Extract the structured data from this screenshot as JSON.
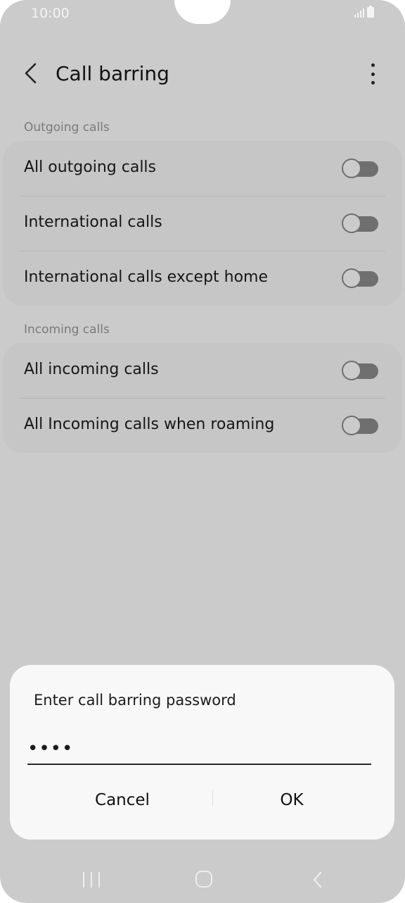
{
  "status_bar": {
    "time": "10:00"
  },
  "header": {
    "title": "Call barring"
  },
  "sections": [
    {
      "title": "Outgoing calls",
      "items": [
        {
          "label": "All outgoing calls",
          "enabled": false
        },
        {
          "label": "International calls",
          "enabled": false
        },
        {
          "label": "International calls except home",
          "enabled": false
        }
      ]
    },
    {
      "title": "Incoming calls",
      "items": [
        {
          "label": "All incoming calls",
          "enabled": false
        },
        {
          "label": "All Incoming calls when roaming",
          "enabled": false
        }
      ]
    }
  ],
  "dialog": {
    "title": "Enter call barring password",
    "password_value": "••••",
    "cancel_label": "Cancel",
    "ok_label": "OK"
  },
  "icons": {
    "back": "back-arrow-icon",
    "more": "more-vertical-icon",
    "signal": "signal-icon",
    "battery": "battery-icon",
    "nav_recent": "recent-apps-icon",
    "nav_home": "home-icon",
    "nav_back": "nav-back-icon"
  },
  "colors": {
    "background": "#cbcbcb",
    "card": "#c6c6c6",
    "toggle_off": "#6f6f6f",
    "dialog": "#f8f8f8"
  }
}
